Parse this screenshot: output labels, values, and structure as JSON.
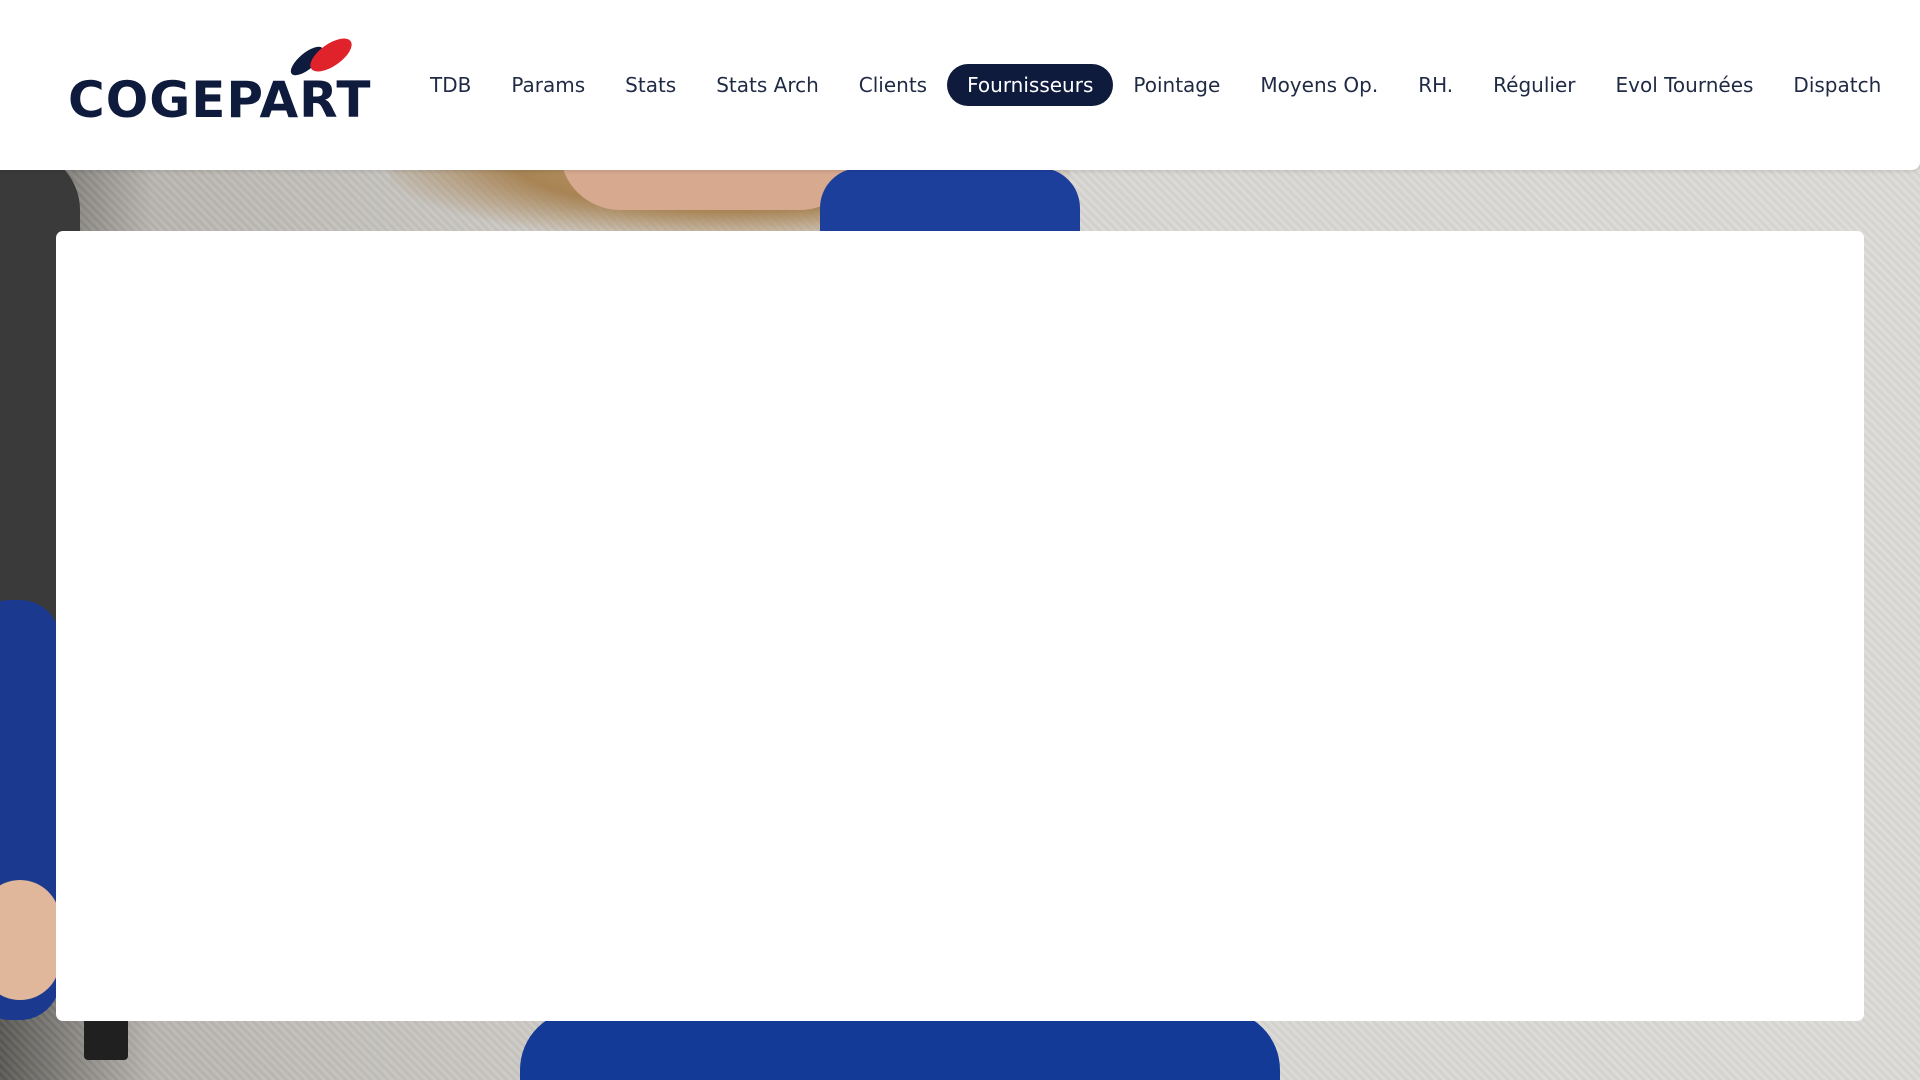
{
  "brand": {
    "name": "COGEPART",
    "colors": {
      "navy": "#0f1b3c",
      "red": "#e0222b"
    }
  },
  "nav": {
    "items": [
      {
        "label": "TDB",
        "active": false
      },
      {
        "label": "Params",
        "active": false
      },
      {
        "label": "Stats",
        "active": false
      },
      {
        "label": "Stats Arch",
        "active": false
      },
      {
        "label": "Clients",
        "active": false
      },
      {
        "label": "Fournisseurs",
        "active": true
      },
      {
        "label": "Pointage",
        "active": false
      },
      {
        "label": "Moyens Op.",
        "active": false
      },
      {
        "label": "RH.",
        "active": false
      },
      {
        "label": "Régulier",
        "active": false
      },
      {
        "label": "Evol Tournées",
        "active": false
      },
      {
        "label": "Dispatch",
        "active": false
      }
    ]
  }
}
